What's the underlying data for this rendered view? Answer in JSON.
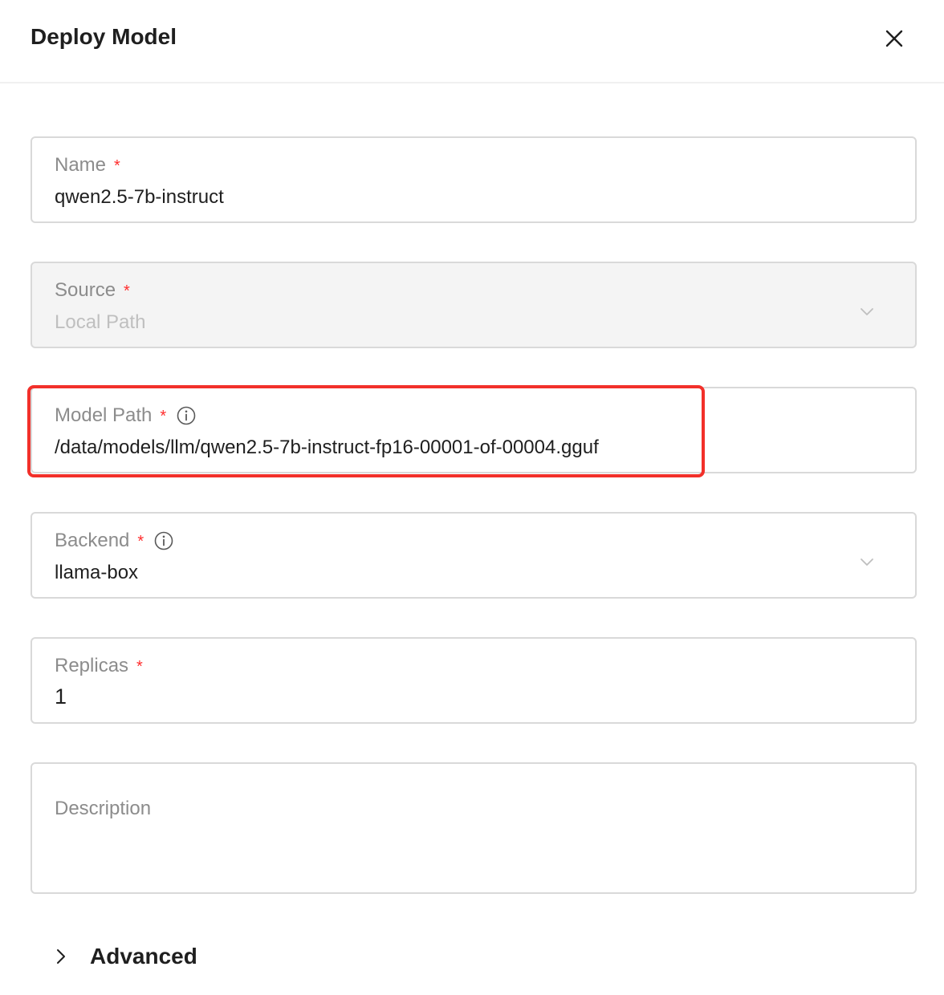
{
  "dialog": {
    "title": "Deploy Model",
    "close_icon": "close-icon"
  },
  "form": {
    "name": {
      "label": "Name",
      "required_mark": "*",
      "value": "qwen2.5-7b-instruct"
    },
    "source": {
      "label": "Source",
      "required_mark": "*",
      "value": "Local Path",
      "disabled": true,
      "icon": "chevron-down-icon"
    },
    "model_path": {
      "label": "Model Path",
      "required_mark": "*",
      "info_icon": "info-icon",
      "value": "/data/models/llm/qwen2.5-7b-instruct-fp16-00001-of-00004.gguf"
    },
    "backend": {
      "label": "Backend",
      "required_mark": "*",
      "info_icon": "info-icon",
      "value": "llama-box",
      "icon": "chevron-down-icon"
    },
    "replicas": {
      "label": "Replicas",
      "required_mark": "*",
      "value": "1"
    },
    "description": {
      "label": "Description",
      "value": ""
    }
  },
  "advanced": {
    "label": "Advanced",
    "icon": "chevron-right-icon"
  },
  "colors": {
    "required": "#ff2d2d",
    "highlight": "#f2302a",
    "border": "#d9d9d9",
    "disabled_bg": "#f4f4f4"
  }
}
